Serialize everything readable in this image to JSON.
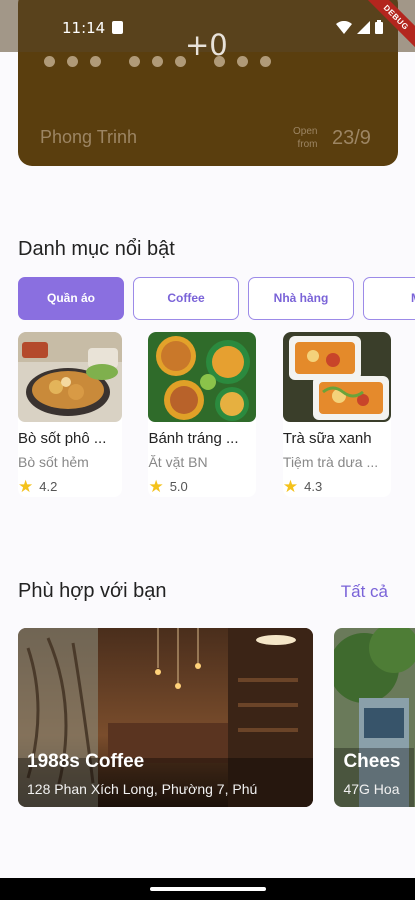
{
  "status": {
    "time": "11:14",
    "debug_label": "DEBUG"
  },
  "card": {
    "counter": "+0",
    "holder": "Phong Trinh",
    "open_label_line1": "Open",
    "open_label_line2": "from",
    "date": "23/9"
  },
  "categories": {
    "title": "Danh mục nổi bật",
    "chips": [
      {
        "label": "Quần áo"
      },
      {
        "label": "Coffee"
      },
      {
        "label": "Nhà hàng"
      },
      {
        "label": "M"
      }
    ],
    "items": [
      {
        "name": "Bò sốt phô ...",
        "sub": "Bò sốt hẻm",
        "rating": "4.2"
      },
      {
        "name": "Bánh tráng ...",
        "sub": "Ăt vặt BN",
        "rating": "5.0"
      },
      {
        "name": "Trà sữa xanh",
        "sub": "Tiệm trà dưa ...",
        "rating": "4.3"
      }
    ]
  },
  "recommend": {
    "title": "Phù hợp với bạn",
    "see_all": "Tất cả",
    "places": [
      {
        "name": "1988s Coffee",
        "address": "128 Phan Xích Long, Phường 7, Phú"
      },
      {
        "name": "Chees",
        "address": "47G Hoa"
      }
    ]
  }
}
